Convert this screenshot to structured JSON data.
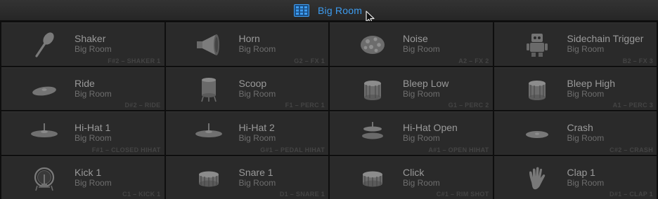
{
  "kit": {
    "name": "Big Room",
    "icon": "drum-kit-grid-icon",
    "accent": "#3d9cf0"
  },
  "pads": [
    {
      "name": "Shaker",
      "kit": "Big Room",
      "note": "F#2 – SHAKER 1",
      "icon": "shaker-icon"
    },
    {
      "name": "Horn",
      "kit": "Big Room",
      "note": "G2 – FX 1",
      "icon": "horn-icon"
    },
    {
      "name": "Noise",
      "kit": "Big Room",
      "note": "A2 – FX 2",
      "icon": "noise-icon"
    },
    {
      "name": "Sidechain Trigger",
      "kit": "Big Room",
      "note": "B2 – FX 3",
      "icon": "robot-icon"
    },
    {
      "name": "Ride",
      "kit": "Big Room",
      "note": "D#2 – RIDE",
      "icon": "ride-cymbal-icon"
    },
    {
      "name": "Scoop",
      "kit": "Big Room",
      "note": "F1 – PERC 1",
      "icon": "scoop-drum-icon"
    },
    {
      "name": "Bleep Low",
      "kit": "Big Room",
      "note": "G1 – PERC 2",
      "icon": "drum-icon"
    },
    {
      "name": "Bleep High",
      "kit": "Big Room",
      "note": "A1 – PERC 3",
      "icon": "drum-icon"
    },
    {
      "name": "Hi-Hat 1",
      "kit": "Big Room",
      "note": "F#1 – CLOSED HIHAT",
      "icon": "hihat-icon"
    },
    {
      "name": "Hi-Hat 2",
      "kit": "Big Room",
      "note": "G#1 – PEDAL HIHAT",
      "icon": "hihat-icon"
    },
    {
      "name": "Hi-Hat Open",
      "kit": "Big Room",
      "note": "A#1 – OPEN HIHAT",
      "icon": "open-hihat-icon"
    },
    {
      "name": "Crash",
      "kit": "Big Room",
      "note": "C#2 – CRASH",
      "icon": "crash-cymbal-icon"
    },
    {
      "name": "Kick 1",
      "kit": "Big Room",
      "note": "C1 – KICK 1",
      "icon": "kick-drum-icon"
    },
    {
      "name": "Snare 1",
      "kit": "Big Room",
      "note": "D1 – SNARE 1",
      "icon": "snare-drum-icon"
    },
    {
      "name": "Click",
      "kit": "Big Room",
      "note": "C#1 – RIM SHOT",
      "icon": "snare-drum-icon"
    },
    {
      "name": "Clap 1",
      "kit": "Big Room",
      "note": "D#1 – CLAP 1",
      "icon": "hand-clap-icon"
    }
  ]
}
